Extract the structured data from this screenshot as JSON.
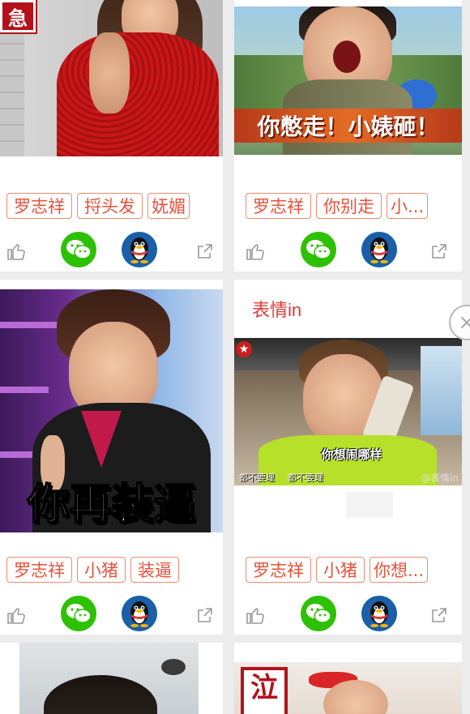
{
  "cards": [
    {
      "tags": [
        "罗志祥",
        "捋头发",
        "妩媚"
      ],
      "caption": "",
      "badge": "急"
    },
    {
      "tags": [
        "罗志祥",
        "你别走",
        "小..."
      ],
      "caption": "你憋走！小婊砸！"
    },
    {
      "tags": [
        "罗志祥",
        "小猪",
        "装逼"
      ],
      "caption": "你再装逼"
    },
    {
      "tags": [
        "罗志祥",
        "小猪",
        "你想..."
      ],
      "caption": "你想闹哪样",
      "subcaption_left": "都不要理",
      "subcaption_mid": "都不要理",
      "subcaption_right": "@表情in",
      "watermark": "表情in"
    },
    {
      "caption": ""
    },
    {
      "caption": "",
      "badge": "泣"
    }
  ],
  "icons": {
    "like": "thumbs-up-icon",
    "wechat": "wechat-icon",
    "qq": "qq-penguin-icon",
    "share": "share-icon",
    "close": "close-icon"
  },
  "colors": {
    "accent": "#e8523a",
    "wechat": "#2dc100",
    "qq": "#1a5fa8",
    "watermark": "#e53935"
  }
}
